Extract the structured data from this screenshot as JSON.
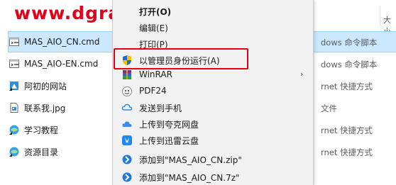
{
  "watermark": {
    "text": "www.dgrai.com",
    "color": "#e0001a"
  },
  "explorer": {
    "size_header": "大小",
    "files": [
      {
        "name": "MAS_AIO_CN.cmd",
        "type": "Windows 命令脚本",
        "type_visible": "dows 命令脚本",
        "icon": "cmd-file-icon",
        "selected": true
      },
      {
        "name": "MAS_AIO-EN.cmd",
        "type": "Windows 命令脚本",
        "type_visible": "dows 命令脚本",
        "icon": "cmd-file-icon",
        "selected": false
      },
      {
        "name": "阿初的网站",
        "type": "Internet 快捷方式",
        "type_visible": "rnet 快捷方式",
        "icon": "internet-shortcut-icon",
        "selected": false
      },
      {
        "name": "联系我.jpg",
        "type": "JPG 文件",
        "type_visible": "文件",
        "icon": "jpg-file-icon",
        "selected": false
      },
      {
        "name": "学习教程",
        "type": "Internet 快捷方式",
        "type_visible": "rnet 快捷方式",
        "icon": "internet-shortcut-icon",
        "selected": false
      },
      {
        "name": "资源目录",
        "type": "Internet 快捷方式",
        "type_visible": "rnet 快捷方式",
        "icon": "internet-shortcut-icon",
        "selected": false
      }
    ]
  },
  "context_menu": {
    "items": [
      {
        "label": "打开(O)",
        "icon": "none",
        "bold": true
      },
      {
        "label": "编辑(E)",
        "icon": "none",
        "bold": false
      },
      {
        "label": "打印(P)",
        "icon": "none",
        "bold": false
      },
      {
        "label": "以管理员身份运行(A)",
        "icon": "uac-shield-icon",
        "bold": false,
        "highlighted": true
      },
      {
        "label": "WinRAR",
        "icon": "winrar-icon",
        "bold": false,
        "submenu": true
      },
      {
        "label": "PDF24",
        "icon": "pdf24-icon",
        "bold": false
      },
      {
        "label": "发送到手机",
        "icon": "phone-cloud-icon",
        "bold": false
      },
      {
        "label": "上传到夸克网盘",
        "icon": "quark-cloud-icon",
        "bold": false
      },
      {
        "label": "上传到迅雷云盘",
        "icon": "xunlei-icon",
        "bold": false
      },
      {
        "label": "添加到\"MAS_AIO_CN.zip\"",
        "icon": "bandizip-icon",
        "bold": false
      },
      {
        "label": "添加到\"MAS_AIO_CN.7z\"",
        "icon": "bandizip-icon",
        "bold": false
      }
    ],
    "highlight_color": "#e60012"
  }
}
